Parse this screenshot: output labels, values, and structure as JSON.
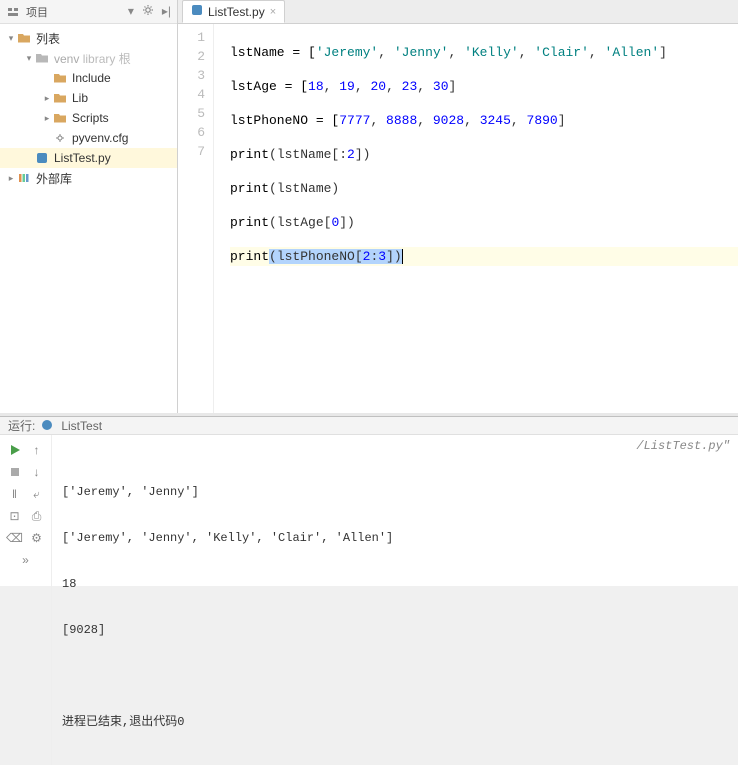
{
  "sidebar": {
    "title": "项目",
    "items": [
      {
        "label": "列表",
        "root": true
      },
      {
        "label": "venv",
        "hint": "library 根"
      },
      {
        "label": "Include"
      },
      {
        "label": "Lib"
      },
      {
        "label": "Scripts"
      },
      {
        "label": "pyvenv.cfg"
      },
      {
        "label": "ListTest.py"
      },
      {
        "label": "外部库"
      }
    ]
  },
  "tab": {
    "filename": "ListTest.py"
  },
  "gutter": {
    "lines": [
      "1",
      "2",
      "3",
      "4",
      "5",
      "6",
      "7"
    ]
  },
  "code": {
    "l1": {
      "a": "lstName = [",
      "s1": "'Jeremy'",
      "c1": ", ",
      "s2": "'Jenny'",
      "c2": ", ",
      "s3": "'Kelly'",
      "c3": ", ",
      "s4": "'Clair'",
      "c4": ", ",
      "s5": "'Allen'",
      "z": "]"
    },
    "l2": {
      "a": "lstAge = [",
      "n1": "18",
      "c1": ", ",
      "n2": "19",
      "c2": ", ",
      "n3": "20",
      "c3": ", ",
      "n4": "23",
      "c4": ", ",
      "n5": "30",
      "z": "]"
    },
    "l3": {
      "a": "lstPhoneNO = [",
      "n1": "7777",
      "c1": ", ",
      "n2": "8888",
      "c2": ", ",
      "n3": "9028",
      "c3": ", ",
      "n4": "3245",
      "c4": ", ",
      "n5": "7890",
      "z": "]"
    },
    "l4": {
      "a": "print",
      "b": "(lstName[:",
      "n": "2",
      "z": "])"
    },
    "l5": {
      "a": "print",
      "b": "(lstName)"
    },
    "l6": {
      "a": "print",
      "b": "(lstAge[",
      "n": "0",
      "z": "])"
    },
    "l7": {
      "a": "print",
      "b": "(lstPhoneNO[",
      "n1": "2",
      "c": ":",
      "n2": "3",
      "z": "])"
    }
  },
  "run": {
    "header_prefix": "运行:",
    "config_name": "ListTest",
    "path_suffix": "/ListTest.py\"",
    "out1": "['Jeremy', 'Jenny']",
    "out2": "['Jeremy', 'Jenny', 'Kelly', 'Clair', 'Allen']",
    "out3": "18",
    "out4": "[9028]",
    "exit_msg": "进程已结束,退出代码0"
  }
}
